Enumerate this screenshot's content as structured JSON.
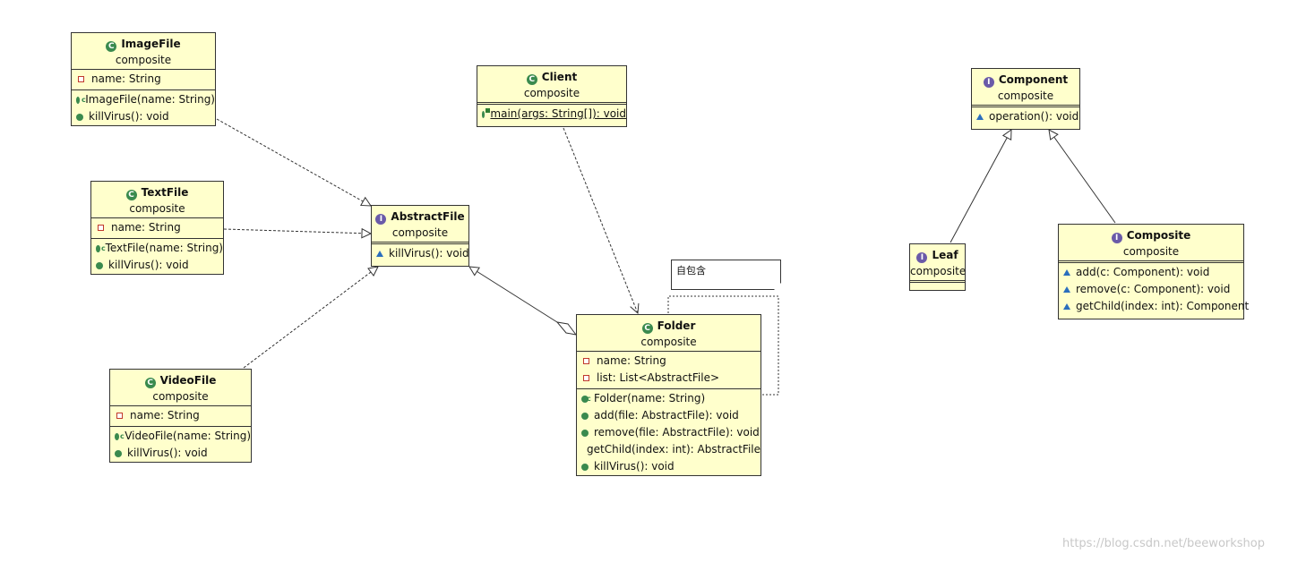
{
  "classes": {
    "imagefile": {
      "name": "ImageFile",
      "package": "composite",
      "kind": "class",
      "fields": [
        "name: String"
      ],
      "methods": [
        "ImageFile(name: String)",
        "killVirus(): void"
      ]
    },
    "textfile": {
      "name": "TextFile",
      "package": "composite",
      "kind": "class",
      "fields": [
        "name: String"
      ],
      "methods": [
        "TextFile(name: String)",
        "killVirus(): void"
      ]
    },
    "videofile": {
      "name": "VideoFile",
      "package": "composite",
      "kind": "class",
      "fields": [
        "name: String"
      ],
      "methods": [
        "VideoFile(name: String)",
        "killVirus(): void"
      ]
    },
    "abstractfile": {
      "name": "AbstractFile",
      "package": "composite",
      "kind": "interface",
      "methods": [
        "killVirus(): void"
      ]
    },
    "client": {
      "name": "Client",
      "package": "composite",
      "kind": "class",
      "methods": [
        "main(args: String[]): void"
      ]
    },
    "folder": {
      "name": "Folder",
      "package": "composite",
      "kind": "class",
      "fields": [
        "name: String",
        "list: List<AbstractFile>"
      ],
      "methods": [
        "Folder(name: String)",
        "add(file: AbstractFile): void",
        "remove(file: AbstractFile): void",
        "getChild(index: int): AbstractFile",
        "killVirus(): void"
      ]
    },
    "component": {
      "name": "Component",
      "package": "composite",
      "kind": "interface",
      "methods": [
        "operation(): void"
      ]
    },
    "leaf": {
      "name": "Leaf",
      "package": "composite",
      "kind": "interface"
    },
    "composite": {
      "name": "Composite",
      "package": "composite",
      "kind": "interface",
      "methods": [
        "add(c: Component): void",
        "remove(c: Component): void",
        "getChild(index: int): Component"
      ]
    }
  },
  "note": {
    "text": "自包含"
  },
  "watermark": "https://blog.csdn.net/beeworkshop",
  "icons": {
    "class": "class-c-icon",
    "interface": "interface-i-icon"
  },
  "colors": {
    "box_fill": "#ffffcc",
    "border": "#333333",
    "class_icon": "#3a8a4e",
    "interface_icon": "#6a5aa8",
    "private_marker": "#c0392b",
    "package_marker": "#2a6ebd"
  }
}
